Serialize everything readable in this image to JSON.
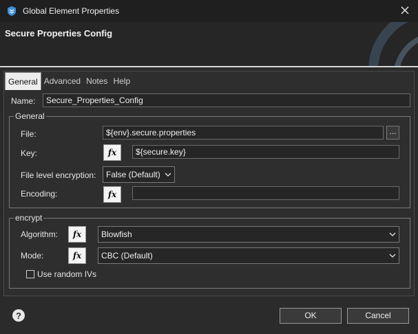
{
  "window": {
    "title": "Global Element Properties",
    "close_icon": "close-icon",
    "app_icon": "mule-shield-icon"
  },
  "banner": {
    "title": "Secure Properties Config"
  },
  "tabs": [
    {
      "label": "General",
      "active": true
    },
    {
      "label": "Advanced",
      "active": false
    },
    {
      "label": "Notes",
      "active": false
    },
    {
      "label": "Help",
      "active": false
    }
  ],
  "name": {
    "label": "Name:",
    "value": "Secure_Properties_Config"
  },
  "general_group": {
    "legend": "General",
    "file": {
      "label": "File:",
      "value": "${env}.secure.properties",
      "browse_label": "..."
    },
    "key": {
      "label": "Key:",
      "value": "${secure.key}",
      "fx_label": "fx"
    },
    "file_encryption": {
      "label": "File level encryption:",
      "value": "False (Default)"
    },
    "encoding": {
      "label": "Encoding:",
      "value": "",
      "fx_label": "fx"
    }
  },
  "encrypt_group": {
    "legend": "encrypt",
    "algorithm": {
      "label": "Algorithm:",
      "value": "Blowfish",
      "fx_label": "fx"
    },
    "mode": {
      "label": "Mode:",
      "value": "CBC (Default)",
      "fx_label": "fx"
    },
    "random_ivs": {
      "label": "Use random IVs",
      "checked": false
    }
  },
  "footer": {
    "ok_label": "OK",
    "cancel_label": "Cancel",
    "help_icon": "help-icon"
  },
  "colors": {
    "background": "#2b2b2b",
    "titlebar": "#1f1f1f",
    "active_tab": "#ededed",
    "accent": "#3a8fd6"
  }
}
